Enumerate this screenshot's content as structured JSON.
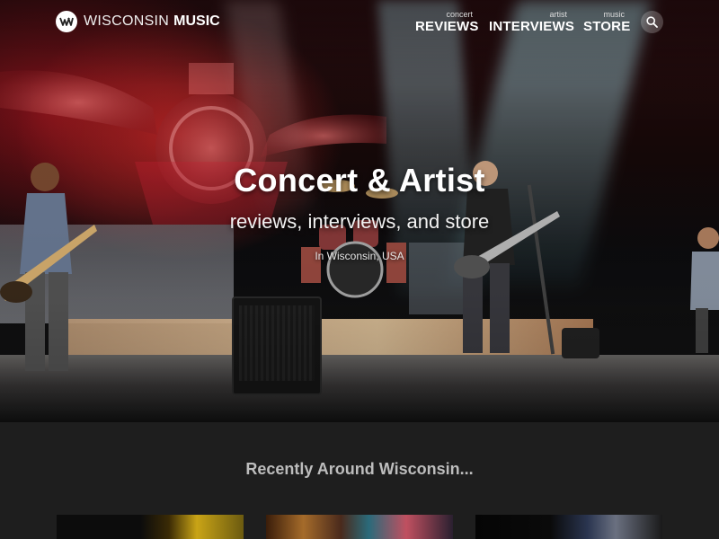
{
  "brand": {
    "name_light": "WISCONSIN",
    "name_bold": "MUSIC",
    "logo_icon": "wm-monogram-icon"
  },
  "nav": {
    "items": [
      {
        "sub": "concert",
        "label": "REVIEWS"
      },
      {
        "sub": "artist",
        "label": "INTERVIEWS"
      },
      {
        "sub": "music",
        "label": "STORE"
      }
    ],
    "search_icon": "search-icon"
  },
  "hero": {
    "title": "Concert & Artist",
    "subtitle": "reviews, interviews, and store",
    "location": "In Wisconsin, USA"
  },
  "recent": {
    "heading": "Recently Around Wisconsin..."
  },
  "colors": {
    "page_background": "#1d1d1d",
    "section_background": "#1e1e1e",
    "heading_gray": "#bdbdbd"
  }
}
